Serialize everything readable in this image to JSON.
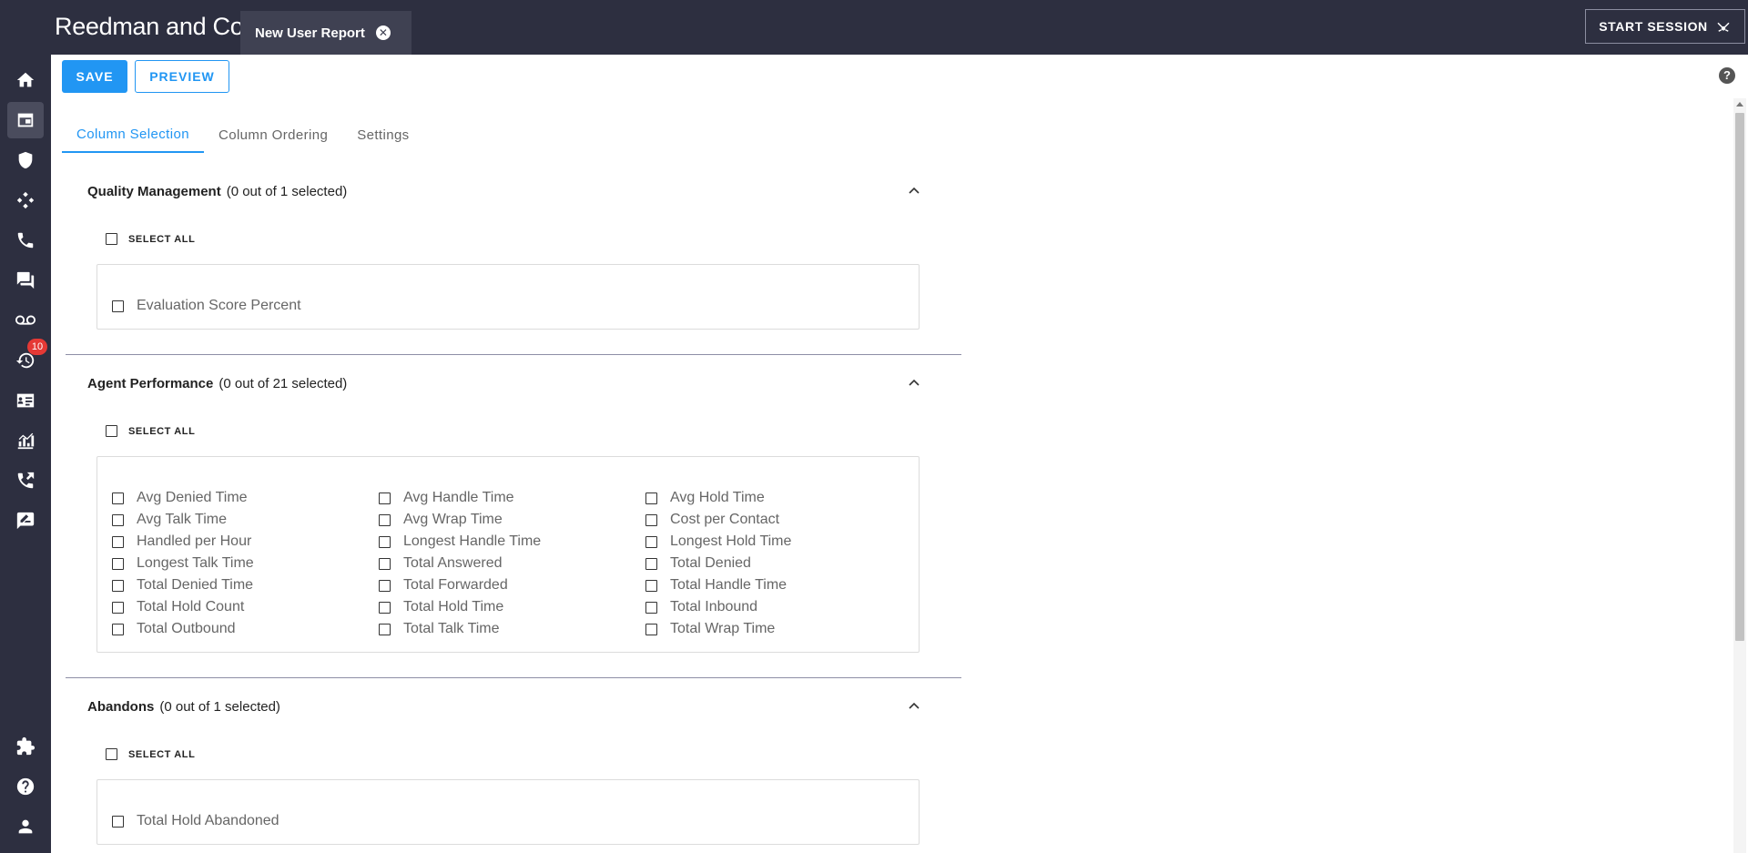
{
  "header": {
    "brand": "Reedman and Co",
    "report_tab": "New User Report",
    "start_session": "START SESSION"
  },
  "rail": {
    "history_badge": "10"
  },
  "toolbar": {
    "save": "SAVE",
    "preview": "PREVIEW"
  },
  "tabs": [
    {
      "label": "Column Selection",
      "active": true
    },
    {
      "label": "Column Ordering",
      "active": false
    },
    {
      "label": "Settings",
      "active": false
    }
  ],
  "select_all_label": "SELECT ALL",
  "sections": [
    {
      "title": "Quality Management",
      "count": "(0 out of 1 selected)",
      "options": [
        "Evaluation Score Percent"
      ]
    },
    {
      "title": "Agent Performance",
      "count": "(0 out of 21 selected)",
      "options": [
        "Avg Denied Time",
        "Avg Handle Time",
        "Avg Hold Time",
        "Avg Talk Time",
        "Avg Wrap Time",
        "Cost per Contact",
        "Handled per Hour",
        "Longest Handle Time",
        "Longest Hold Time",
        "Longest Talk Time",
        "Total Answered",
        "Total Denied",
        "Total Denied Time",
        "Total Forwarded",
        "Total Handle Time",
        "Total Hold Count",
        "Total Hold Time",
        "Total Inbound",
        "Total Outbound",
        "Total Talk Time",
        "Total Wrap Time"
      ]
    },
    {
      "title": "Abandons",
      "count": "(0 out of 1 selected)",
      "options": [
        "Total Hold Abandoned"
      ]
    }
  ]
}
